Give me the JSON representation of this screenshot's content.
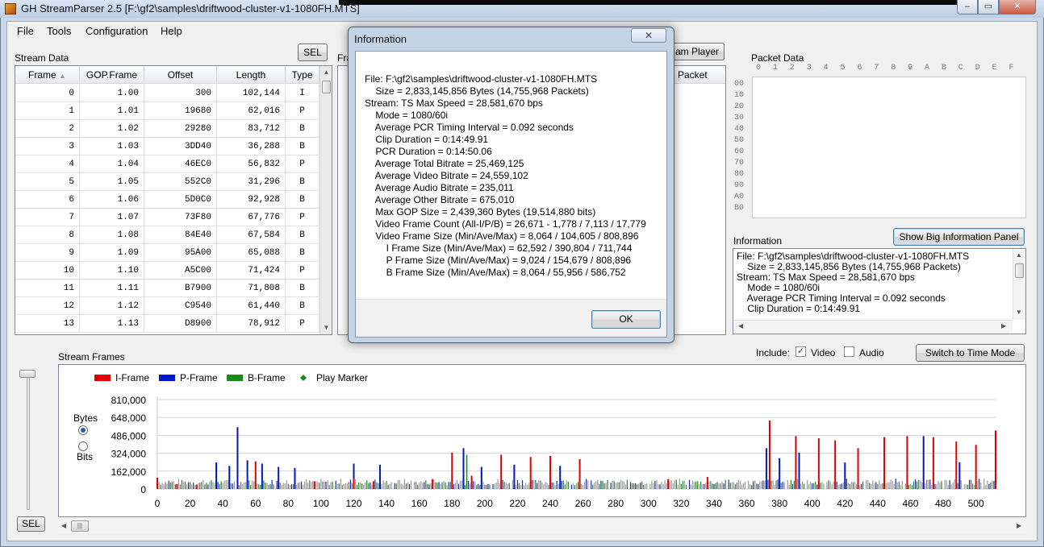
{
  "window": {
    "title": "GH StreamParser 2.5 [F:\\gf2\\samples\\driftwood-cluster-v1-1080FH.MTS]",
    "min_glyph": "▭",
    "max_glyph": "▭",
    "close_glyph": "✕"
  },
  "menu": [
    "File",
    "Tools",
    "Configuration",
    "Help"
  ],
  "stream_data": {
    "label": "Stream Data",
    "sel_button": "SEL",
    "headers": [
      "Frame",
      "GOP.Frame",
      "Offset",
      "Length",
      "Type"
    ],
    "rows": [
      [
        "0",
        "1.00",
        "300",
        "102,144",
        "I"
      ],
      [
        "1",
        "1.01",
        "19680",
        "62,016",
        "P"
      ],
      [
        "2",
        "1.02",
        "29280",
        "83,712",
        "B"
      ],
      [
        "3",
        "1.03",
        "3DD40",
        "36,288",
        "B"
      ],
      [
        "4",
        "1.04",
        "46EC0",
        "56,832",
        "P"
      ],
      [
        "5",
        "1.05",
        "552C0",
        "31,296",
        "B"
      ],
      [
        "6",
        "1.06",
        "5D0C0",
        "92,928",
        "B"
      ],
      [
        "7",
        "1.07",
        "73F80",
        "67,776",
        "P"
      ],
      [
        "8",
        "1.08",
        "84E40",
        "67,584",
        "B"
      ],
      [
        "9",
        "1.09",
        "95A00",
        "65,088",
        "B"
      ],
      [
        "10",
        "1.10",
        "A5C00",
        "71,424",
        "P"
      ],
      [
        "11",
        "1.11",
        "B7900",
        "71,808",
        "B"
      ],
      [
        "12",
        "1.12",
        "C9540",
        "61,440",
        "B"
      ],
      [
        "13",
        "1.13",
        "D8900",
        "78,912",
        "P"
      ]
    ]
  },
  "middle": {
    "frame_label_partial": "Fra",
    "stream_player_button": "am Player",
    "packet_header": "Packet"
  },
  "packet_data": {
    "label": "Packet Data",
    "col_headers": [
      "0",
      "1",
      "2",
      "3",
      "4",
      "5",
      "6",
      "7",
      "8",
      "9",
      "A",
      "B",
      "C",
      "D",
      "E",
      "F"
    ],
    "row_headers": [
      "00",
      "10",
      "20",
      "30",
      "40",
      "50",
      "60",
      "70",
      "80",
      "90",
      "A0",
      "B0"
    ]
  },
  "info_panel": {
    "label": "Information",
    "show_big_button": "Show Big Information Panel",
    "lines": [
      "File: F:\\gf2\\samples\\driftwood-cluster-v1-1080FH.MTS",
      "    Size = 2,833,145,856 Bytes (14,755,968 Packets)",
      "Stream: TS Max Speed = 28,581,670 bps",
      "    Mode = 1080/60i",
      "    Average PCR Timing Interval = 0.092 seconds",
      "    Clip Duration = 0:14:49.91"
    ]
  },
  "stream_frames": {
    "label": "Stream Frames",
    "include_label": "Include:",
    "video_label": "Video",
    "video_checked": true,
    "audio_label": "Audio",
    "audio_checked": false,
    "switch_button": "Switch to Time Mode",
    "bytes_label": "Bytes",
    "bits_label": "Bits",
    "sel_button": "SEL",
    "scroll_thumb": "|||"
  },
  "chart_data": {
    "type": "bar",
    "legend": [
      {
        "name": "I-Frame",
        "color": "#e00000"
      },
      {
        "name": "P-Frame",
        "color": "#0018c8"
      },
      {
        "name": "B-Frame",
        "color": "#1a8a1a"
      },
      {
        "name": "Play Marker",
        "color": "#1a8a1a"
      }
    ],
    "y_ticks": [
      "810,000",
      "648,000",
      "486,000",
      "324,000",
      "162,000",
      "0"
    ],
    "y_tick_values": [
      810000,
      648000,
      486000,
      324000,
      162000,
      0
    ],
    "x_ticks": [
      "0",
      "20",
      "40",
      "60",
      "80",
      "100",
      "120",
      "140",
      "160",
      "180",
      "200",
      "220",
      "240",
      "260",
      "280",
      "300",
      "320",
      "340",
      "360",
      "380",
      "400",
      "420",
      "440",
      "460",
      "480",
      "500"
    ],
    "x_tick_values": [
      0,
      20,
      40,
      60,
      80,
      100,
      120,
      140,
      160,
      180,
      200,
      220,
      240,
      260,
      280,
      300,
      320,
      340,
      360,
      380,
      400,
      420,
      440,
      460,
      480,
      500
    ],
    "xlim": [
      0,
      512
    ],
    "ylim": [
      0,
      810000
    ],
    "frame_count": 512,
    "gop_length": 12,
    "i_frames": [
      {
        "x": 0,
        "value": 102144
      },
      {
        "x": 12,
        "value": 45000
      },
      {
        "x": 24,
        "value": 40000
      },
      {
        "x": 60,
        "value": 250000
      },
      {
        "x": 96,
        "value": 70000
      },
      {
        "x": 120,
        "value": 90000
      },
      {
        "x": 132,
        "value": 70000
      },
      {
        "x": 168,
        "value": 90000
      },
      {
        "x": 180,
        "value": 330000
      },
      {
        "x": 192,
        "value": 120000
      },
      {
        "x": 210,
        "value": 310000
      },
      {
        "x": 228,
        "value": 290000
      },
      {
        "x": 240,
        "value": 300000
      },
      {
        "x": 258,
        "value": 270000
      },
      {
        "x": 312,
        "value": 90000
      },
      {
        "x": 336,
        "value": 110000
      },
      {
        "x": 374,
        "value": 620000
      },
      {
        "x": 390,
        "value": 480000
      },
      {
        "x": 404,
        "value": 460000
      },
      {
        "x": 414,
        "value": 440000
      },
      {
        "x": 428,
        "value": 370000
      },
      {
        "x": 444,
        "value": 470000
      },
      {
        "x": 458,
        "value": 480000
      },
      {
        "x": 474,
        "value": 470000
      },
      {
        "x": 488,
        "value": 430000
      },
      {
        "x": 500,
        "value": 400000
      },
      {
        "x": 512,
        "value": 530000
      }
    ],
    "p_frame_peaks": [
      {
        "x": 49,
        "value": 560000
      },
      {
        "x": 36,
        "value": 240000
      },
      {
        "x": 44,
        "value": 210000
      },
      {
        "x": 55,
        "value": 260000
      },
      {
        "x": 64,
        "value": 230000
      },
      {
        "x": 74,
        "value": 200000
      },
      {
        "x": 84,
        "value": 190000
      },
      {
        "x": 120,
        "value": 230000
      },
      {
        "x": 136,
        "value": 220000
      },
      {
        "x": 187,
        "value": 370000
      },
      {
        "x": 198,
        "value": 200000
      },
      {
        "x": 218,
        "value": 220000
      },
      {
        "x": 246,
        "value": 210000
      },
      {
        "x": 372,
        "value": 370000
      },
      {
        "x": 380,
        "value": 280000
      },
      {
        "x": 392,
        "value": 330000
      },
      {
        "x": 420,
        "value": 240000
      },
      {
        "x": 468,
        "value": 480000
      },
      {
        "x": 490,
        "value": 240000
      }
    ],
    "p_frame_typical": 104605,
    "b_frame_typical": 55956
  },
  "dialog": {
    "title": "Information",
    "close_glyph": "✕",
    "lines": [
      "File: F:\\gf2\\samples\\driftwood-cluster-v1-1080FH.MTS",
      "    Size = 2,833,145,856 Bytes (14,755,968 Packets)",
      "Stream: TS Max Speed = 28,581,670 bps",
      "    Mode = 1080/60i",
      "    Average PCR Timing Interval = 0.092 seconds",
      "    Clip Duration = 0:14:49.91",
      "    PCR Duration = 0:14:50.06",
      "    Average Total Bitrate = 25,469,125",
      "    Average Video Bitrate = 24,559,102",
      "    Average Audio Bitrate = 235,011",
      "    Average Other Bitrate = 675,010",
      "    Max GOP Size = 2,439,360 Bytes (19,514,880 bits)",
      "    Video Frame Count (All-I/P/B) = 26,671 - 1,778 / 7,113 / 17,779",
      "    Video Frame Size (Min/Ave/Max) = 8,064 / 104,605 / 808,896",
      "        I Frame Size (Min/Ave/Max) = 62,592 / 390,804 / 711,744",
      "        P Frame Size (Min/Ave/Max) = 9,024 / 154,679 / 808,896",
      "        B Frame Size (Min/Ave/Max) = 8,064 / 55,956 / 586,752"
    ],
    "ok_button": "OK"
  }
}
